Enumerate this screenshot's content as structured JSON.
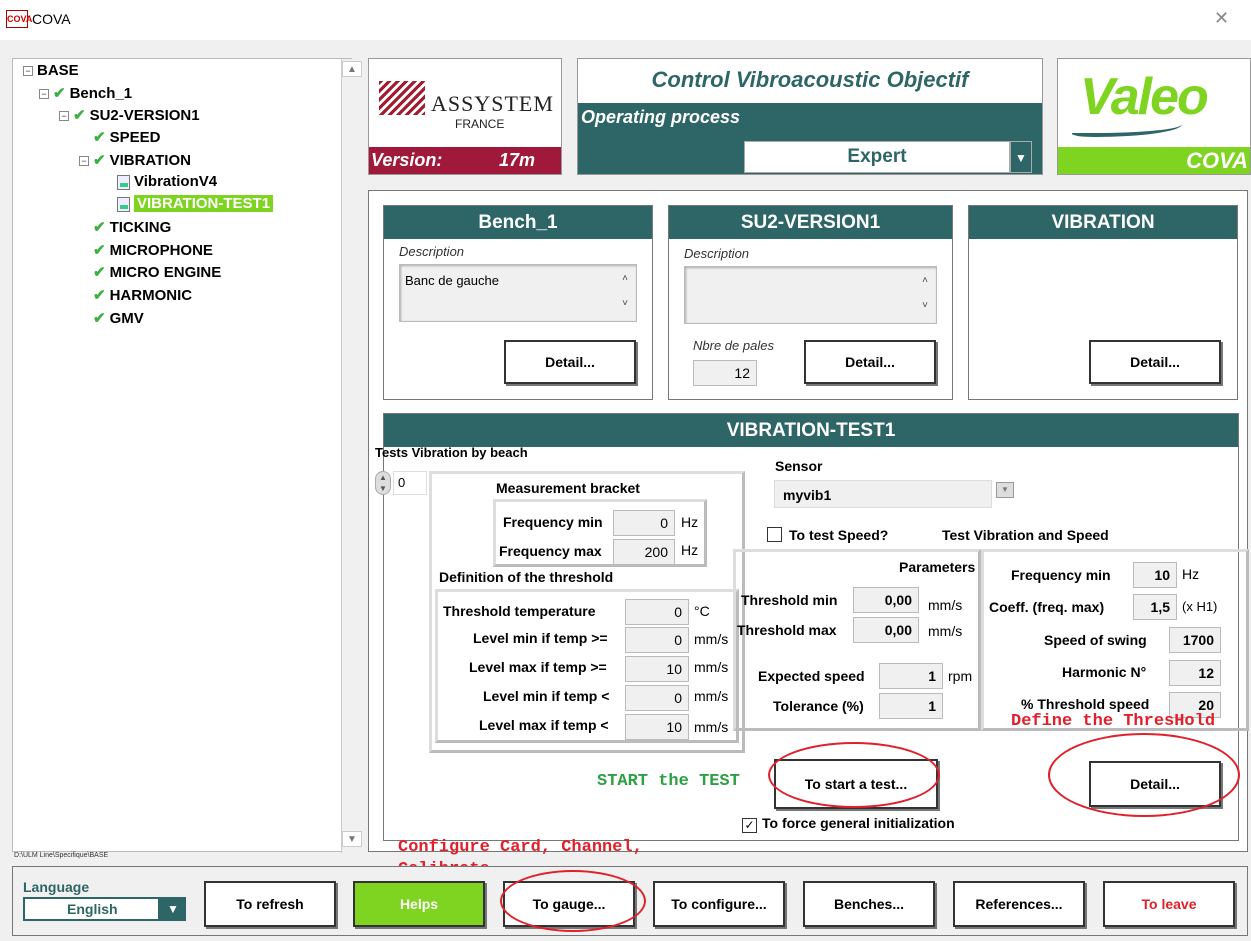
{
  "window": {
    "title": "COVA",
    "icon_text": "COVA"
  },
  "tree": {
    "items": [
      {
        "label": "BASE"
      },
      {
        "label": "Bench_1"
      },
      {
        "label": "SU2-VERSION1"
      },
      {
        "label": "SPEED"
      },
      {
        "label": "VIBRATION"
      },
      {
        "label": "VibrationV4"
      },
      {
        "label": "VIBRATION-TEST1"
      },
      {
        "label": "TICKING"
      },
      {
        "label": "MICROPHONE"
      },
      {
        "label": "MICRO ENGINE"
      },
      {
        "label": "HARMONIC"
      },
      {
        "label": "GMV"
      }
    ],
    "path": "D:\\ULM Line\\Specifique\\BASE"
  },
  "header": {
    "assystem_name": "ASSYSTEM",
    "assystem_sub": "FRANCE",
    "version_label": "Version:",
    "version_value": "17m",
    "app_title": "Control Vibroacoustic Objectif",
    "operating_label": "Operating process",
    "mode": "Expert",
    "valeo_logo": "Valeo",
    "cova_label": "COVA"
  },
  "cards": {
    "bench": {
      "title": "Bench_1",
      "desc_label": "Description",
      "desc_value": "Banc de gauche",
      "detail": "Detail..."
    },
    "version": {
      "title": "SU2-VERSION1",
      "desc_label": "Description",
      "desc_value": "",
      "pales_label": "Nbre de pales",
      "pales_value": "12",
      "detail": "Detail..."
    },
    "vibration": {
      "title": "VIBRATION",
      "detail": "Detail..."
    }
  },
  "test": {
    "title": "VIBRATION-TEST1",
    "tests_by_beach": "Tests Vibration by beach",
    "spinner_value": "0",
    "measurement_bracket": "Measurement bracket",
    "freq_min_label": "Frequency min",
    "freq_min_value": "0",
    "hz": "Hz",
    "freq_max_label": "Frequency max",
    "freq_max_value": "200",
    "threshold_def": "Definition of the threshold",
    "thr_temp_label": "Threshold temperature",
    "thr_temp_value": "0",
    "deg_c": "°C",
    "lvl_min_ge_label": "Level min if temp >=",
    "lvl_min_ge_value": "0",
    "lvl_max_ge_label": "Level max if temp >=",
    "lvl_max_ge_value": "10",
    "lvl_min_lt_label": "Level min if temp <",
    "lvl_min_lt_value": "0",
    "lvl_max_lt_label": "Level max if temp <",
    "lvl_max_lt_value": "10",
    "mms": "mm/s",
    "sensor_label": "Sensor",
    "sensor_value": "myvib1",
    "test_speed_label": "To test Speed?",
    "test_vib_speed": "Test Vibration and Speed",
    "parameters": "Parameters",
    "thr_min_label": "Threshold min",
    "thr_min_value": "0,00",
    "thr_max_label": "Threshold max",
    "thr_max_value": "0,00",
    "expected_speed_label": "Expected speed",
    "expected_speed_value": "1",
    "rpm": "rpm",
    "tolerance_label": "Tolerance (%)",
    "tolerance_value": "1",
    "p_freq_min_label": "Frequency min",
    "p_freq_min_value": "10",
    "coeff_label": "Coeff. (freq. max)",
    "coeff_value": "1,5",
    "xh1": "(x H1)",
    "swing_label": "Speed of swing",
    "swing_value": "1700",
    "harmonic_label": "Harmonic N°",
    "harmonic_value": "12",
    "thr_speed_label": "% Threshold speed",
    "thr_speed_value": "20",
    "start_btn": "To start a test...",
    "detail_btn": "Detail...",
    "force_init": "To force general initialization"
  },
  "annotations": {
    "start": "START the TEST",
    "define": "Define the ThresHold",
    "configure_1": "Configure Card, Channel,",
    "configure_2": "Calibrate",
    "color_red": "#e0202a",
    "color_green": "#2ea043"
  },
  "bottom": {
    "language_label": "Language",
    "language_value": "English",
    "refresh": "To refresh",
    "helps": "Helps",
    "gauge": "To gauge...",
    "configure": "To configure...",
    "benches": "Benches...",
    "references": "References...",
    "leave": "To leave"
  },
  "colors": {
    "teal": "#2e6566",
    "green": "#7fd321",
    "crimson": "#a0183a"
  }
}
